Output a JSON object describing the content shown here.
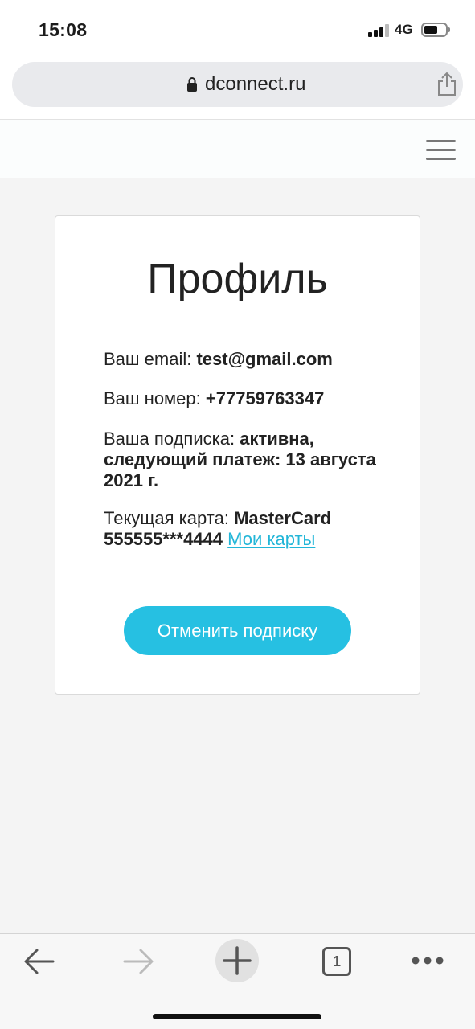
{
  "status_bar": {
    "time": "15:08",
    "network": "4G"
  },
  "browser": {
    "url": "dconnect.ru"
  },
  "profile": {
    "title": "Профиль",
    "email_label": "Ваш email:",
    "email_value": "test@gmail.com",
    "phone_label": "Ваш номер:",
    "phone_value": "+77759763347",
    "subscription_label": "Ваша подписка:",
    "subscription_value": "активна, следующий платеж: 13 августа 2021 г.",
    "card_label": "Текущая карта:",
    "card_value": "MasterCard 555555***4444",
    "my_cards_link": "Мои карты",
    "cancel_button": "Отменить подписку"
  },
  "toolbar": {
    "tab_count": "1"
  },
  "colors": {
    "accent": "#26c0e2",
    "link": "#22b6d8",
    "background": "#f4f4f4"
  },
  "icons": [
    "lock-icon",
    "share-icon",
    "hamburger-menu-icon",
    "back-arrow-icon",
    "forward-arrow-icon",
    "new-tab-plus-icon",
    "tabs-icon",
    "more-icon"
  ]
}
